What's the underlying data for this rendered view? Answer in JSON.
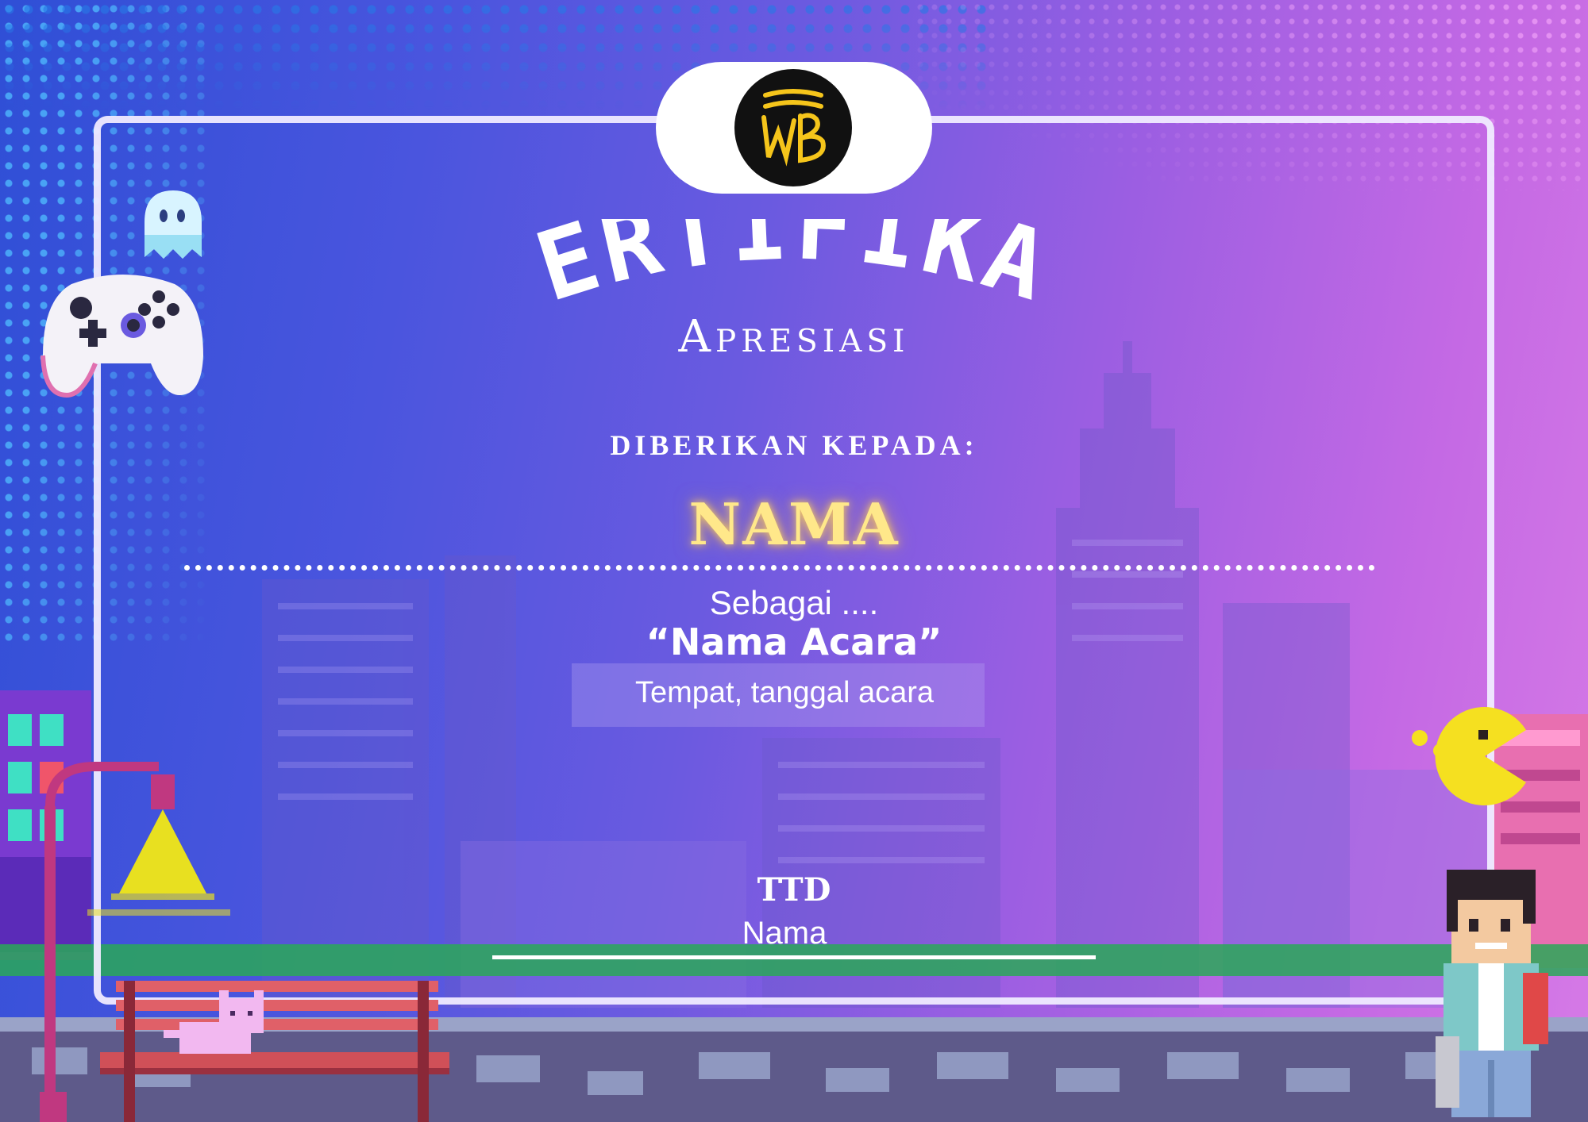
{
  "logo": {
    "text": "WB",
    "background": "#111111",
    "color": "#f5c51b"
  },
  "certificate": {
    "title": "SERTIFIKAT",
    "subtitle": "Apresiasi",
    "given_to": "diberikan kepada:",
    "recipient_name": "NAMA",
    "role": "Sebagai ....",
    "event_name": "“Nama Acara”",
    "place_date": "Tempat, tanggal acara",
    "signature_label": "TTD",
    "signature_name": "Nama"
  },
  "colors": {
    "background_left": "#2f4fd6",
    "background_right": "#d67ae6",
    "frame": "#f0ebff",
    "name_glow": "#ffe88a",
    "text": "#ffffff"
  },
  "icons": [
    "ghost-icon",
    "game-controller-icon",
    "pacman-icon",
    "street-lamp-icon",
    "bench-icon",
    "pixel-cat-icon",
    "pixel-boy-icon"
  ]
}
